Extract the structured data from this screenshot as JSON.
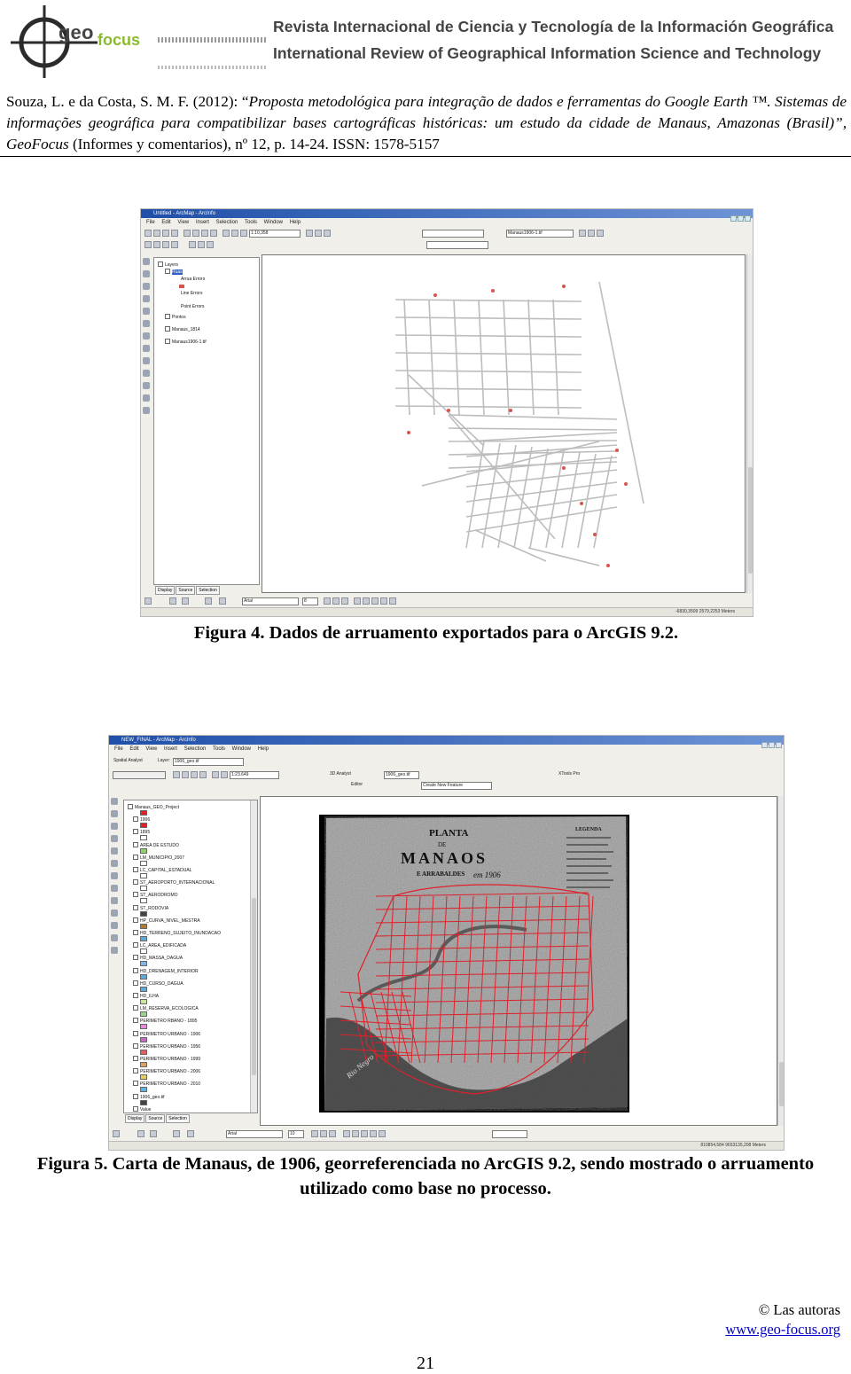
{
  "header": {
    "logo_text": "geofocus",
    "journal_es": "Revista Internacional de Ciencia y Tecnología de la Información Geográfica",
    "journal_en": "International Review of Geographical Information Science and Technology"
  },
  "citation": {
    "authors": "Souza, L. e da Costa, S. M. F. (2012): “",
    "title": "Proposta metodológica para integração de dados e ferramentas do Google Earth ™. Sistemas de informações geográfica para compatibilizar bases cartográficas históricas: um estudo da cidade de Manaus, Amazonas (Brasil)",
    "close": "”, ",
    "journal": "GeoFocus",
    "rest": " (Informes y comentarios), nº 12, p. 14-24. ISSN: 1578-5157"
  },
  "figure4": {
    "window_title": "Untitled - ArcMap - ArcInfo",
    "menu": [
      "File",
      "Edit",
      "View",
      "Insert",
      "Selection",
      "Tools",
      "Window",
      "Help"
    ],
    "scale": "1:10,358",
    "layer_combo": "Manaus1906-1.tif",
    "toc_items": [
      "Layers",
      "Ruas",
      "Arrua Errors",
      "Line Errors",
      "Point Errors",
      "Pontos",
      "Manaus_1814",
      "Manaus1906-1.tif"
    ],
    "tabs": [
      "Display",
      "Source",
      "Selection"
    ],
    "font_combo": "Arial",
    "size_combo": "8",
    "status": "-6830,3509  2579,2253 Meters",
    "caption": "Figura 4. Dados de arruamento exportados para o ArcGIS 9.2."
  },
  "figure5": {
    "window_title": "NEW_FINAL - ArcMap - ArcInfo",
    "menu": [
      "File",
      "Edit",
      "View",
      "Insert",
      "Selection",
      "Tools",
      "Window",
      "Help"
    ],
    "toolbar_spatial": "Spatial Analyst",
    "layer_label": "Layer:",
    "layer_combo": "1906_geo.tif",
    "layer_combo2": "1906_geo.tif",
    "scale": "1:23.649",
    "analyst_3d": "3D Analyst",
    "editor": "Editor",
    "task": "Create New Feature",
    "xtools": "XTools Pro",
    "toc_items": [
      "Manaus_GEO_Project",
      "1906",
      "1895",
      "AREA DE ESTUDO",
      "LM_MUNICIPIO_2007",
      "LC_CAPITAL_ESTADUAL",
      "ST_AEROPORTO_INTERNACIONAL",
      "ST_AERODROMO",
      "ST_RODOVIA",
      "HP_CURVA_NIVEL_MESTRA",
      "HD_TERRENO_SUJEITO_INUNDACAO",
      "LC_AREA_EDIFICADA",
      "HD_MASSA_DAGUA",
      "HD_DRENAGEM_INTERIOR",
      "HD_CURSO_DAGUA",
      "HD_ILHA",
      "LM_RESERVA_ECOLOGICA",
      "PERIMETRO RBANO - 1895",
      "PERIMETRO URBANO - 1906",
      "PERIMETRO URBANO - 1956",
      "PERIMETRO URBANO - 1999",
      "PERIMETRO URBANO - 2006",
      "PERIMETRO URBANO - 2010",
      "1906_geo.tif",
      "Value"
    ],
    "tabs": [
      "Display",
      "Source",
      "Selection"
    ],
    "font_combo": "Arial",
    "size_combo": "10",
    "status": "810854,584  9653135,208 Meters",
    "map_title": "PLANTA",
    "map_de": "DE",
    "map_city": "MANAOS",
    "map_arrabaldes": "E ARRABALDES",
    "map_year": "em 1906",
    "map_legend": "LEGENDA",
    "map_river": "Rio Negro",
    "caption": "Figura 5. Carta de Manaus, de 1906, georreferenciada no ArcGIS 9.2, sendo mostrado o arruamento utilizado como base no processo."
  },
  "footer": {
    "copyright": "© Las autoras",
    "url": "www.geo-focus.org",
    "page": "21"
  },
  "colors": {
    "street_line": "#bdbdbd",
    "street_point": "#d9534f",
    "overlay_red": "#e0202a",
    "titlebar_blue": "#1f4fa8",
    "link_blue": "#0000cc"
  }
}
